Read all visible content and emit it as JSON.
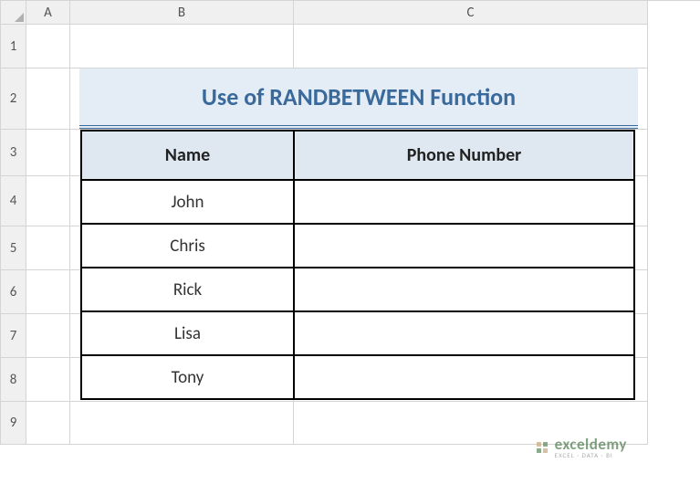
{
  "columns": [
    "A",
    "B",
    "C"
  ],
  "rows": [
    "1",
    "2",
    "3",
    "4",
    "5",
    "6",
    "7",
    "8",
    "9"
  ],
  "title": "Use of RANDBETWEEN Function",
  "table": {
    "headers": [
      "Name",
      "Phone Number"
    ],
    "data": [
      [
        "John",
        ""
      ],
      [
        "Chris",
        ""
      ],
      [
        "Rick",
        ""
      ],
      [
        "Lisa",
        ""
      ],
      [
        "Tony",
        ""
      ]
    ]
  },
  "watermark": {
    "main": "exceldemy",
    "sub": "EXCEL · DATA · BI"
  }
}
